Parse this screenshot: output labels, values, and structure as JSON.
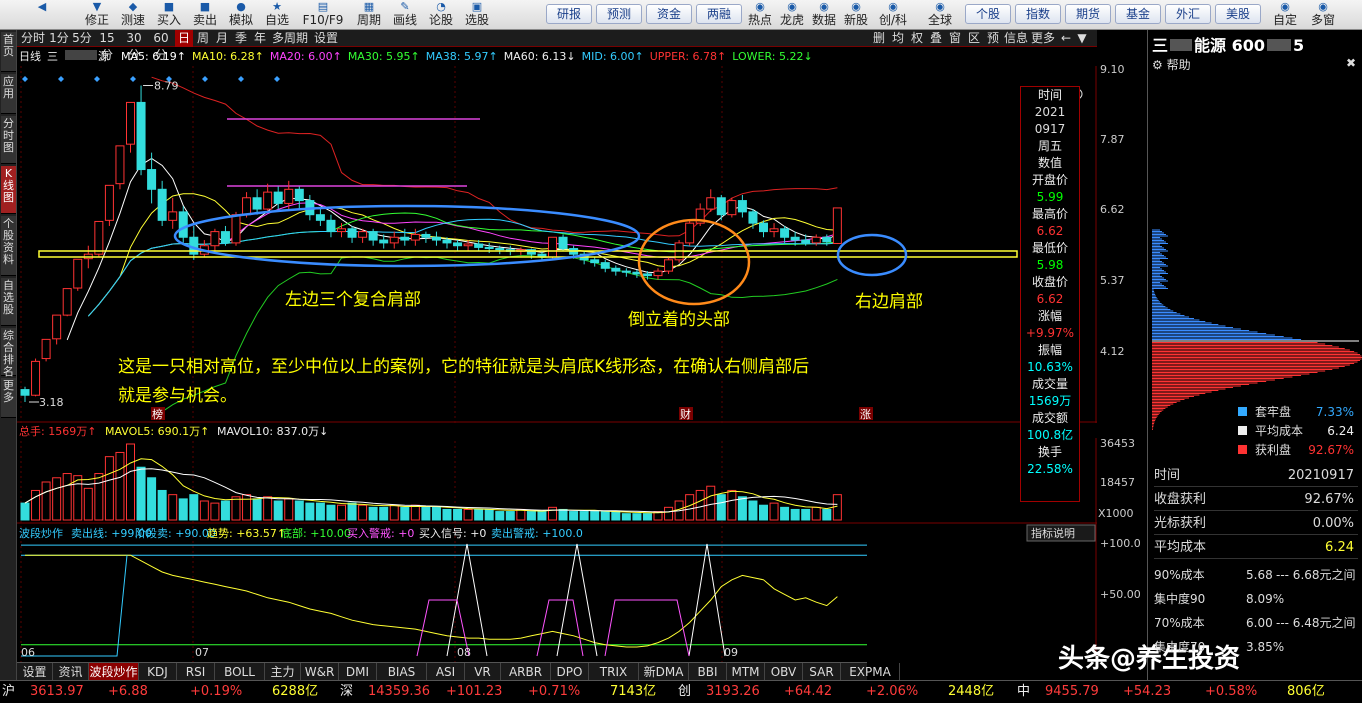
{
  "toolbar": {
    "buttons": [
      {
        "icon": "◀",
        "label": ""
      },
      {
        "icon": "▼",
        "label": "修正"
      },
      {
        "icon": "◆",
        "label": "测速"
      },
      {
        "icon": "■",
        "label": "买入"
      },
      {
        "icon": "■",
        "label": "卖出"
      },
      {
        "icon": "●",
        "label": "模拟"
      },
      {
        "icon": "★",
        "label": "自选"
      },
      {
        "icon": "▤",
        "label": "F10/F9"
      },
      {
        "icon": "▦",
        "label": "周期"
      },
      {
        "icon": "✎",
        "label": "画线"
      },
      {
        "icon": "◔",
        "label": "论股"
      },
      {
        "icon": "▣",
        "label": "选股"
      }
    ],
    "pills": [
      "研报",
      "预测",
      "资金",
      "两融",
      "个股",
      "指数",
      "期货",
      "基金",
      "外汇",
      "美股"
    ],
    "mid_buttons": [
      {
        "icon": "◉",
        "label": "热点"
      },
      {
        "icon": "◉",
        "label": "龙虎"
      },
      {
        "icon": "◉",
        "label": "数据"
      },
      {
        "icon": "◉",
        "label": "新股"
      },
      {
        "icon": "◉",
        "label": "创/科"
      },
      {
        "icon": "◉",
        "label": "全球"
      }
    ],
    "right_buttons": [
      {
        "icon": "◉",
        "label": "自定"
      },
      {
        "icon": "◉",
        "label": "多窗"
      }
    ]
  },
  "leftnav": [
    "首页",
    "应用",
    "分时图",
    "K线图",
    "个股资料",
    "自选股",
    "综合排名",
    "更多"
  ],
  "period": {
    "tabs": [
      "分时",
      "1分",
      "5分",
      "15分",
      "30分",
      "60分",
      "日",
      "周",
      "月",
      "季",
      "年",
      "多周期",
      "设置"
    ],
    "active": "日",
    "right_tools": [
      "删",
      "均",
      "权",
      "叠",
      "窗",
      "区",
      "预",
      "信息",
      "更多"
    ]
  },
  "mabar": {
    "label": "日线",
    "stock": "三",
    "stock_tail": "源",
    "items": [
      {
        "text": "MA5: 6.19↑",
        "color": "#ffffff"
      },
      {
        "text": "MA10: 6.28↑",
        "color": "#ffff33"
      },
      {
        "text": "MA20: 6.00↑",
        "color": "#ff44ff"
      },
      {
        "text": "MA30: 5.95↑",
        "color": "#33ff33"
      },
      {
        "text": "MA38: 5.97↑",
        "color": "#33ccff"
      },
      {
        "text": "MA60: 6.13↓",
        "color": "#eeeeee"
      },
      {
        "text": "MID: 6.00↑",
        "color": "#33ccff"
      },
      {
        "text": "UPPER: 6.78↑",
        "color": "#ff3333"
      },
      {
        "text": "LOWER: 5.22↓",
        "color": "#33ff33"
      }
    ]
  },
  "price_axis": [
    "9.10",
    "7.87",
    "6.62",
    "5.37",
    "4.12"
  ],
  "volume_axis": [
    "36453",
    "18457",
    "X1000"
  ],
  "indicator_axis": [
    "+100.0",
    "+50.00"
  ],
  "high_label": "8.79",
  "low_label": "3.18",
  "month_labels": [
    "06",
    "07",
    "08",
    "09"
  ],
  "markers": [
    "榜",
    "财",
    "涨"
  ],
  "volume_bar": {
    "items": [
      {
        "text": "总手: 1569万↑",
        "color": "#ff3333"
      },
      {
        "text": "MAVOL5: 690.1万↑",
        "color": "#ffff33"
      },
      {
        "text": "MAVOL10: 837.0万↓",
        "color": "#eeeeee"
      }
    ]
  },
  "indicator_bar": {
    "items": [
      {
        "text": "波段炒作",
        "color": "#33ccff"
      },
      {
        "text": "卖出线: +99.00",
        "color": "#33ccff"
      },
      {
        "text": "阶段卖: +90.00",
        "color": "#33ccff"
      },
      {
        "text": "趋势: +63.57↑",
        "color": "#ffff33"
      },
      {
        "text": "底部: +10.00",
        "color": "#33ff33"
      },
      {
        "text": "买入警戒: +0",
        "color": "#ff55ff"
      },
      {
        "text": "买入信号: +0",
        "color": "#eeeeee"
      },
      {
        "text": "卖出警戒: +100.0",
        "color": "#33ccff"
      }
    ],
    "button": "指标说明"
  },
  "infobox": [
    {
      "label": "时间",
      "value": "2021",
      "cls": "w"
    },
    {
      "label": "",
      "value": "0917",
      "cls": "w"
    },
    {
      "label": "周五",
      "value": "",
      "cls": "w"
    },
    {
      "label": "数值",
      "value": "",
      "cls": "w"
    },
    {
      "label": "开盘价",
      "value": "5.99",
      "cls": "vg"
    },
    {
      "label": "最高价",
      "value": "6.62",
      "cls": "vr"
    },
    {
      "label": "最低价",
      "value": "5.98",
      "cls": "vg"
    },
    {
      "label": "收盘价",
      "value": "6.62",
      "cls": "vr"
    },
    {
      "label": "涨幅",
      "value": "+9.97%",
      "cls": "vr"
    },
    {
      "label": "振幅",
      "value": "10.63%",
      "cls": "v"
    },
    {
      "label": "成交量",
      "value": "1569万",
      "cls": "v"
    },
    {
      "label": "成交额",
      "value": "100.8亿",
      "cls": "v"
    },
    {
      "label": "换手",
      "value": "22.58%",
      "cls": "v"
    }
  ],
  "annotations": {
    "left": "左边三个复合肩部",
    "head": "倒立着的头部",
    "right": "右边肩部",
    "note1": "这是一只相对高位，至少中位以上的案例，它的特征就是头肩底K线形态，在确认右侧肩部后",
    "note2": "就是参与机会。"
  },
  "rpanel": {
    "title": "三",
    "title2": "能源 600",
    "title3": "5",
    "help": "帮助",
    "legend": [
      {
        "label": "套牢盘",
        "value": "7.33%",
        "color": "#33aaff"
      },
      {
        "label": "平均成本",
        "value": "6.24",
        "color": "#eeeeee"
      },
      {
        "label": "获利盘",
        "value": "92.67%",
        "color": "#ff3333"
      }
    ],
    "rows": [
      {
        "label": "时间",
        "value": "20210917"
      },
      {
        "label": "收盘获利",
        "value": "92.67%"
      },
      {
        "label": "光标获利",
        "value": "0.00%"
      },
      {
        "label": "平均成本",
        "value": "6.24"
      }
    ],
    "cost_rows": [
      {
        "label": "90%成本",
        "a": "5.68",
        "b": "--- 6.68元之间"
      },
      {
        "label": "集中度90",
        "a": "8.09%",
        "b": ""
      },
      {
        "label": "70%成本",
        "a": "6.00",
        "b": "--- 6.48元之间"
      },
      {
        "label": "集中度70",
        "a": "3.85%",
        "b": ""
      }
    ],
    "watermark": "头条@养生投资"
  },
  "bottom_tabs": [
    "设置",
    "资讯",
    "波段炒作",
    "KDJ",
    "RSI",
    "BOLL",
    "主力",
    "W&R",
    "DMI",
    "BIAS",
    "ASI",
    "VR",
    "ARBR",
    "DPO",
    "TRIX",
    "新DMA",
    "BBI",
    "MTM",
    "OBV",
    "SAR",
    "EXPMA"
  ],
  "bottom_active": "波段炒作",
  "status": [
    {
      "label": "沪",
      "val": "3613.97",
      "chg": "+6.88",
      "pct": "+0.19%",
      "amt": "6288亿"
    },
    {
      "label": "深",
      "val": "14359.36",
      "chg": "+101.23",
      "pct": "+0.71%",
      "amt": "7143亿"
    },
    {
      "label": "创",
      "val": "3193.26",
      "chg": "+64.42",
      "pct": "+2.06%",
      "amt": "2448亿"
    },
    {
      "label": "中",
      "val": "9455.79",
      "chg": "+54.23",
      "pct": "+0.58%",
      "amt": "806亿"
    }
  ],
  "chart_data": {
    "type": "candlestick",
    "ylim": [
      3.18,
      9.1
    ],
    "candles": [
      [
        3.4,
        3.3,
        3.45,
        3.18
      ],
      [
        3.3,
        3.9,
        3.95,
        3.28
      ],
      [
        3.95,
        4.29,
        4.29,
        3.9
      ],
      [
        4.3,
        4.72,
        4.72,
        4.2
      ],
      [
        4.72,
        5.19,
        5.19,
        4.7
      ],
      [
        5.2,
        5.71,
        5.71,
        5.15
      ],
      [
        5.72,
        5.8,
        5.95,
        5.55
      ],
      [
        5.8,
        6.38,
        6.38,
        5.75
      ],
      [
        6.4,
        7.02,
        7.02,
        6.3
      ],
      [
        7.05,
        7.72,
        7.72,
        6.95
      ],
      [
        7.75,
        8.49,
        8.49,
        7.6
      ],
      [
        8.49,
        7.3,
        8.79,
        7.2
      ],
      [
        7.3,
        6.95,
        7.6,
        6.7
      ],
      [
        6.95,
        6.4,
        7.1,
        6.3
      ],
      [
        6.4,
        6.55,
        6.8,
        6.25
      ],
      [
        6.55,
        6.1,
        6.65,
        6.0
      ],
      [
        6.1,
        5.8,
        6.3,
        5.7
      ],
      [
        5.8,
        5.95,
        6.05,
        5.75
      ],
      [
        5.95,
        6.2,
        6.25,
        5.85
      ],
      [
        6.2,
        6.0,
        6.3,
        5.95
      ],
      [
        6.0,
        6.5,
        6.55,
        5.95
      ],
      [
        6.5,
        6.8,
        6.9,
        6.45
      ],
      [
        6.8,
        6.6,
        6.95,
        6.5
      ],
      [
        6.6,
        6.9,
        7.05,
        6.55
      ],
      [
        6.9,
        6.7,
        7.0,
        6.6
      ],
      [
        6.7,
        6.95,
        7.1,
        6.6
      ],
      [
        6.95,
        6.75,
        7.0,
        6.6
      ],
      [
        6.75,
        6.5,
        6.85,
        6.4
      ],
      [
        6.5,
        6.4,
        6.6,
        6.3
      ],
      [
        6.4,
        6.2,
        6.5,
        6.1
      ],
      [
        6.2,
        6.25,
        6.35,
        6.1
      ],
      [
        6.25,
        6.1,
        6.3,
        6.0
      ],
      [
        6.1,
        6.2,
        6.25,
        6.0
      ],
      [
        6.2,
        6.05,
        6.25,
        5.95
      ],
      [
        6.05,
        6.0,
        6.15,
        5.9
      ],
      [
        6.0,
        6.1,
        6.2,
        5.9
      ],
      [
        6.1,
        6.05,
        6.25,
        5.95
      ],
      [
        6.05,
        6.15,
        6.25,
        5.95
      ],
      [
        6.15,
        6.1,
        6.2,
        6.0
      ],
      [
        6.1,
        6.05,
        6.2,
        5.95
      ],
      [
        6.05,
        6.0,
        6.1,
        5.9
      ],
      [
        6.0,
        5.95,
        6.05,
        5.85
      ],
      [
        5.95,
        5.98,
        6.05,
        5.85
      ],
      [
        5.98,
        5.92,
        6.05,
        5.85
      ],
      [
        5.92,
        5.9,
        6.0,
        5.82
      ],
      [
        5.9,
        5.88,
        5.95,
        5.8
      ],
      [
        5.88,
        5.85,
        5.95,
        5.78
      ],
      [
        5.85,
        5.88,
        5.92,
        5.78
      ],
      [
        5.88,
        5.8,
        5.9,
        5.72
      ],
      [
        5.8,
        5.75,
        5.85,
        5.7
      ],
      [
        5.75,
        6.1,
        6.1,
        5.72
      ],
      [
        6.1,
        5.9,
        6.15,
        5.85
      ],
      [
        5.9,
        5.8,
        5.95,
        5.72
      ],
      [
        5.8,
        5.7,
        5.85,
        5.62
      ],
      [
        5.7,
        5.65,
        5.75,
        5.58
      ],
      [
        5.65,
        5.55,
        5.7,
        5.48
      ],
      [
        5.55,
        5.5,
        5.6,
        5.42
      ],
      [
        5.5,
        5.48,
        5.55,
        5.4
      ],
      [
        5.48,
        5.45,
        5.52,
        5.38
      ],
      [
        5.45,
        5.42,
        5.5,
        5.35
      ],
      [
        5.42,
        5.5,
        5.55,
        5.35
      ],
      [
        5.5,
        5.7,
        5.75,
        5.45
      ],
      [
        5.7,
        6.0,
        6.05,
        5.65
      ],
      [
        6.0,
        6.35,
        6.4,
        5.95
      ],
      [
        6.35,
        6.6,
        6.7,
        6.3
      ],
      [
        6.6,
        6.8,
        6.95,
        6.55
      ],
      [
        6.8,
        6.5,
        6.85,
        6.4
      ],
      [
        6.5,
        6.75,
        6.8,
        6.45
      ],
      [
        6.75,
        6.55,
        6.85,
        6.45
      ],
      [
        6.55,
        6.35,
        6.6,
        6.25
      ],
      [
        6.35,
        6.2,
        6.4,
        6.1
      ],
      [
        6.2,
        6.25,
        6.35,
        6.1
      ],
      [
        6.25,
        6.1,
        6.3,
        6.0
      ],
      [
        6.1,
        6.05,
        6.2,
        5.95
      ],
      [
        6.05,
        6.0,
        6.15,
        5.95
      ],
      [
        6.0,
        6.1,
        6.15,
        5.95
      ],
      [
        6.1,
        6.02,
        6.15,
        5.95
      ],
      [
        5.99,
        6.62,
        6.62,
        5.98
      ]
    ],
    "volume": [
      8,
      14,
      18,
      20,
      22,
      21,
      15,
      22,
      30,
      32,
      36,
      25,
      20,
      14,
      12,
      10,
      12,
      9,
      8,
      9,
      11,
      12,
      10,
      11,
      9,
      10,
      9,
      8,
      8,
      7,
      7,
      8,
      7,
      6,
      6,
      7,
      6,
      7,
      6,
      6,
      5,
      5,
      5,
      5,
      5,
      4,
      4,
      5,
      4,
      4,
      6,
      5,
      4,
      4,
      4,
      4,
      4,
      3,
      3,
      3,
      4,
      6,
      9,
      12,
      14,
      16,
      12,
      14,
      11,
      9,
      7,
      8,
      6,
      5,
      5,
      6,
      5,
      12
    ]
  }
}
